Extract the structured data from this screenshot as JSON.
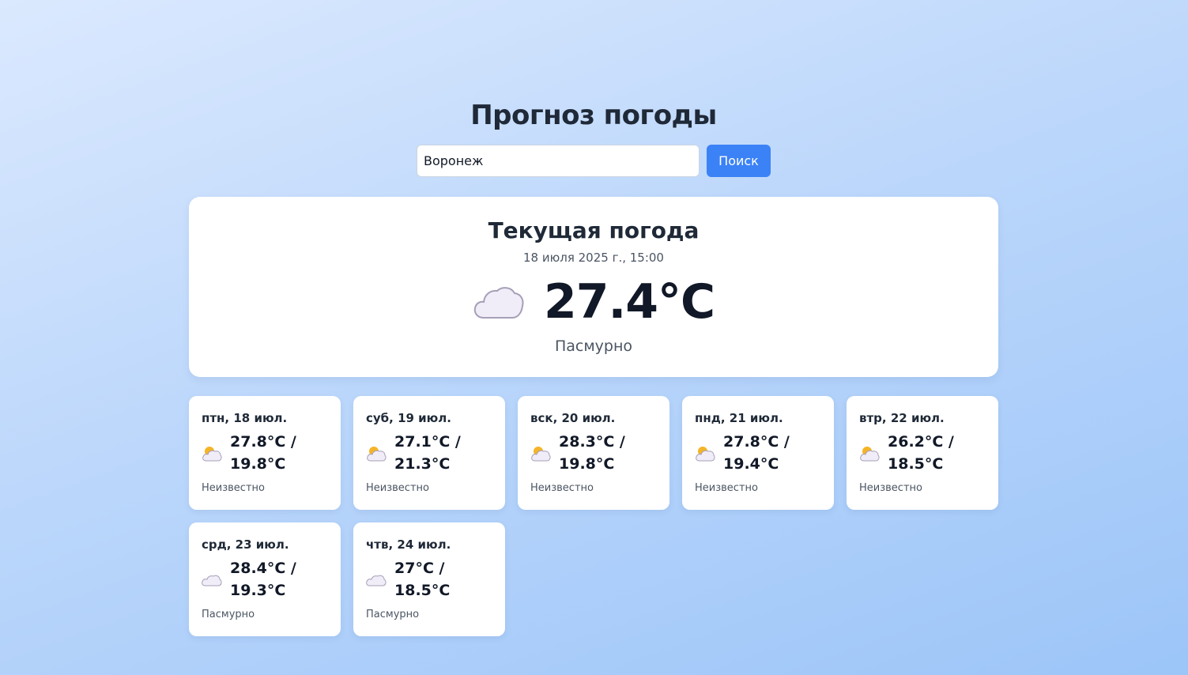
{
  "header": {
    "title": "Прогноз погоды"
  },
  "search": {
    "value": "Воронеж",
    "button_label": "Поиск"
  },
  "current": {
    "title": "Текущая погода",
    "datetime": "18 июля 2025 г., 15:00",
    "icon": "cloud-icon",
    "temperature": "27.4°C",
    "description": "Пасмурно"
  },
  "forecast": [
    {
      "date": "птн, 18 июл.",
      "icon": "partly-cloudy-icon",
      "temp_line1": "27.8°C /",
      "temp_line2": "19.8°C",
      "description": "Неизвестно"
    },
    {
      "date": "суб, 19 июл.",
      "icon": "partly-cloudy-icon",
      "temp_line1": "27.1°C /",
      "temp_line2": "21.3°C",
      "description": "Неизвестно"
    },
    {
      "date": "вск, 20 июл.",
      "icon": "partly-cloudy-icon",
      "temp_line1": "28.3°C /",
      "temp_line2": "19.8°C",
      "description": "Неизвестно"
    },
    {
      "date": "пнд, 21 июл.",
      "icon": "partly-cloudy-icon",
      "temp_line1": "27.8°C /",
      "temp_line2": "19.4°C",
      "description": "Неизвестно"
    },
    {
      "date": "втр, 22 июл.",
      "icon": "partly-cloudy-icon",
      "temp_line1": "26.2°C /",
      "temp_line2": "18.5°C",
      "description": "Неизвестно"
    },
    {
      "date": "срд, 23 июл.",
      "icon": "cloud-icon",
      "temp_line1": "28.4°C /",
      "temp_line2": "19.3°C",
      "description": "Пасмурно"
    },
    {
      "date": "чтв, 24 июл.",
      "icon": "cloud-icon",
      "temp_line1": "27°C /",
      "temp_line2": "18.5°C",
      "description": "Пасмурно"
    }
  ],
  "colors": {
    "accent": "#3b82f6",
    "cloud_fill": "#f1edf8",
    "cloud_stroke": "#a79fb8",
    "sun": "#f5b428"
  }
}
